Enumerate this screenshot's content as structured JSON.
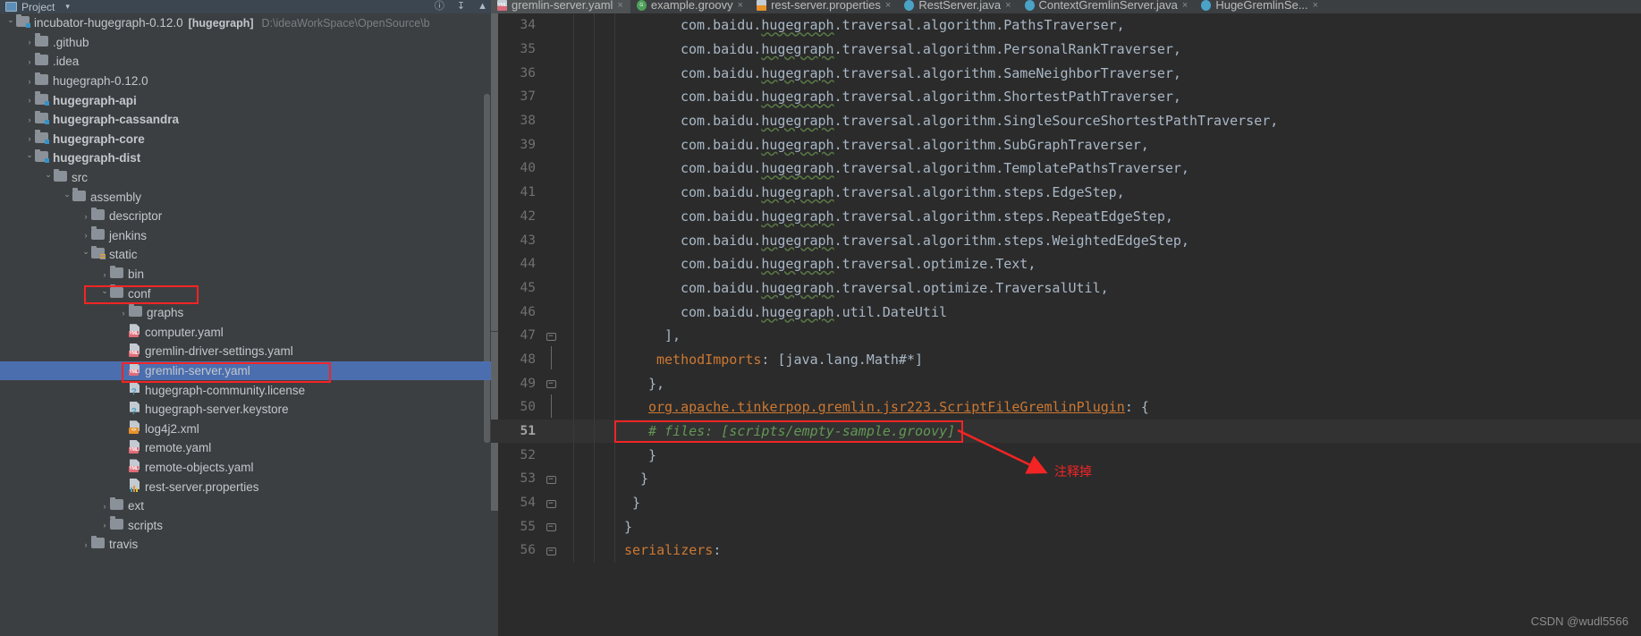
{
  "window": {
    "tool_window_title": "Project",
    "tool_window_caret": "▾",
    "toolbar_icons": [
      "locate-icon",
      "collapse-all-icon",
      "hide-icon"
    ]
  },
  "tabs": [
    {
      "label": "gremlin-server.yaml",
      "icon": "yaml-file-icon",
      "active": true,
      "close": "×"
    },
    {
      "label": "example.groovy",
      "icon": "groovy-file-icon",
      "active": false,
      "close": "×"
    },
    {
      "label": "rest-server.properties",
      "icon": "properties-file-icon",
      "active": false,
      "close": "×"
    },
    {
      "label": "RestServer.java",
      "icon": "java-file-icon",
      "active": false,
      "close": "×"
    },
    {
      "label": "ContextGremlinServer.java",
      "icon": "java-file-icon",
      "active": false,
      "close": "×"
    },
    {
      "label": "HugeGremlinSe...",
      "icon": "java-file-icon",
      "active": false,
      "close": "×"
    }
  ],
  "tree": [
    {
      "label": "incubator-hugegraph-0.12.0",
      "suffix": "[hugegraph]",
      "path": "D:\\ideaWorkSpace\\OpenSource\\b",
      "indent": 0,
      "state": "open",
      "icon": "module-folder-icon",
      "bold": false
    },
    {
      "label": ".github",
      "indent": 1,
      "state": "closed",
      "icon": "folder-icon",
      "bold": false
    },
    {
      "label": ".idea",
      "indent": 1,
      "state": "closed",
      "icon": "folder-icon",
      "bold": false
    },
    {
      "label": "hugegraph-0.12.0",
      "indent": 1,
      "state": "closed",
      "icon": "folder-icon",
      "bold": false
    },
    {
      "label": "hugegraph-api",
      "indent": 1,
      "state": "closed",
      "icon": "module-folder-icon",
      "bold": true
    },
    {
      "label": "hugegraph-cassandra",
      "indent": 1,
      "state": "closed",
      "icon": "module-folder-icon",
      "bold": true
    },
    {
      "label": "hugegraph-core",
      "indent": 1,
      "state": "closed",
      "icon": "module-folder-icon",
      "bold": true
    },
    {
      "label": "hugegraph-dist",
      "indent": 1,
      "state": "open",
      "icon": "module-folder-icon",
      "bold": true
    },
    {
      "label": "src",
      "indent": 2,
      "state": "open",
      "icon": "folder-icon",
      "bold": false
    },
    {
      "label": "assembly",
      "indent": 3,
      "state": "open",
      "icon": "folder-icon",
      "bold": false
    },
    {
      "label": "descriptor",
      "indent": 4,
      "state": "closed",
      "icon": "folder-icon",
      "bold": false
    },
    {
      "label": "jenkins",
      "indent": 4,
      "state": "closed",
      "icon": "folder-icon",
      "bold": false
    },
    {
      "label": "static",
      "indent": 4,
      "state": "open",
      "icon": "resource-folder-icon",
      "bold": false
    },
    {
      "label": "bin",
      "indent": 5,
      "state": "closed",
      "icon": "folder-icon",
      "bold": false
    },
    {
      "label": "conf",
      "indent": 5,
      "state": "open",
      "icon": "folder-icon",
      "bold": false,
      "highlight_box": true
    },
    {
      "label": "graphs",
      "indent": 6,
      "state": "closed",
      "icon": "folder-icon",
      "bold": false
    },
    {
      "label": "computer.yaml",
      "indent": 6,
      "state": "none",
      "icon": "yaml-file-icon",
      "bold": false
    },
    {
      "label": "gremlin-driver-settings.yaml",
      "indent": 6,
      "state": "none",
      "icon": "yaml-file-icon",
      "bold": false
    },
    {
      "label": "gremlin-server.yaml",
      "indent": 6,
      "state": "none",
      "icon": "yaml-file-icon",
      "bold": false,
      "selected": true,
      "highlight_box": true
    },
    {
      "label": "hugegraph-community.license",
      "indent": 6,
      "state": "none",
      "icon": "unknown-file-icon",
      "bold": false
    },
    {
      "label": "hugegraph-server.keystore",
      "indent": 6,
      "state": "none",
      "icon": "unknown-file-icon",
      "bold": false
    },
    {
      "label": "log4j2.xml",
      "indent": 6,
      "state": "none",
      "icon": "xml-file-icon",
      "bold": false
    },
    {
      "label": "remote.yaml",
      "indent": 6,
      "state": "none",
      "icon": "yaml-file-icon",
      "bold": false
    },
    {
      "label": "remote-objects.yaml",
      "indent": 6,
      "state": "none",
      "icon": "yaml-file-icon",
      "bold": false
    },
    {
      "label": "rest-server.properties",
      "indent": 6,
      "state": "none",
      "icon": "properties-file-icon",
      "bold": false
    },
    {
      "label": "ext",
      "indent": 5,
      "state": "closed",
      "icon": "folder-icon",
      "bold": false
    },
    {
      "label": "scripts",
      "indent": 5,
      "state": "closed",
      "icon": "folder-icon",
      "bold": false
    },
    {
      "label": "travis",
      "indent": 4,
      "state": "closed",
      "icon": "folder-icon",
      "bold": false
    }
  ],
  "editor": {
    "lines": [
      {
        "num": "34",
        "fold": "",
        "indent": 10,
        "text": "com.baidu.hugegraph.traversal.algorithm.PathsTraverser,",
        "style": "import"
      },
      {
        "num": "35",
        "fold": "",
        "indent": 10,
        "text": "com.baidu.hugegraph.traversal.algorithm.PersonalRankTraverser,",
        "style": "import"
      },
      {
        "num": "36",
        "fold": "",
        "indent": 10,
        "text": "com.baidu.hugegraph.traversal.algorithm.SameNeighborTraverser,",
        "style": "import"
      },
      {
        "num": "37",
        "fold": "",
        "indent": 10,
        "text": "com.baidu.hugegraph.traversal.algorithm.ShortestPathTraverser,",
        "style": "import"
      },
      {
        "num": "38",
        "fold": "",
        "indent": 10,
        "text": "com.baidu.hugegraph.traversal.algorithm.SingleSourceShortestPathTraverser,",
        "style": "import"
      },
      {
        "num": "39",
        "fold": "",
        "indent": 10,
        "text": "com.baidu.hugegraph.traversal.algorithm.SubGraphTraverser,",
        "style": "import"
      },
      {
        "num": "40",
        "fold": "",
        "indent": 10,
        "text": "com.baidu.hugegraph.traversal.algorithm.TemplatePathsTraverser,",
        "style": "import"
      },
      {
        "num": "41",
        "fold": "",
        "indent": 10,
        "text": "com.baidu.hugegraph.traversal.algorithm.steps.EdgeStep,",
        "style": "import"
      },
      {
        "num": "42",
        "fold": "",
        "indent": 10,
        "text": "com.baidu.hugegraph.traversal.algorithm.steps.RepeatEdgeStep,",
        "style": "import"
      },
      {
        "num": "43",
        "fold": "",
        "indent": 10,
        "text": "com.baidu.hugegraph.traversal.algorithm.steps.WeightedEdgeStep,",
        "style": "import"
      },
      {
        "num": "44",
        "fold": "",
        "indent": 10,
        "text": "com.baidu.hugegraph.traversal.optimize.Text,",
        "style": "import"
      },
      {
        "num": "45",
        "fold": "",
        "indent": 10,
        "text": "com.baidu.hugegraph.traversal.optimize.TraversalUtil,",
        "style": "import"
      },
      {
        "num": "46",
        "fold": "",
        "indent": 10,
        "text": "com.baidu.hugegraph.util.DateUtil",
        "style": "import"
      },
      {
        "num": "47",
        "fold": "minus",
        "indent": 8,
        "text": "],",
        "style": "plain"
      },
      {
        "num": "48",
        "fold": "bar",
        "indent": 7,
        "text": "methodImports: [java.lang.Math#*]",
        "style": "keyvalue",
        "key": "methodImports",
        "value": " [java.lang.Math#*]"
      },
      {
        "num": "49",
        "fold": "minus",
        "indent": 6,
        "text": "},",
        "style": "plain"
      },
      {
        "num": "50",
        "fold": "bar",
        "indent": 6,
        "text": "org.apache.tinkerpop.gremlin.jsr223.ScriptFileGremlinPlugin: {",
        "style": "keyvalue-underline",
        "key": "org.apache.tinkerpop.gremlin.jsr223.ScriptFileGremlinPlugin",
        "value": " {"
      },
      {
        "num": "51",
        "fold": "",
        "indent": 6,
        "text": "# files: [scripts/empty-sample.groovy]",
        "style": "comment",
        "current": true,
        "bold_num": true,
        "highlight_box": true
      },
      {
        "num": "52",
        "fold": "",
        "indent": 6,
        "text": "}",
        "style": "plain"
      },
      {
        "num": "53",
        "fold": "minus",
        "indent": 5,
        "text": "}",
        "style": "plain"
      },
      {
        "num": "54",
        "fold": "minus",
        "indent": 4,
        "text": "}",
        "style": "plain"
      },
      {
        "num": "55",
        "fold": "minus",
        "indent": 3,
        "text": "}",
        "style": "plain"
      },
      {
        "num": "56",
        "fold": "minus",
        "indent": 3,
        "text": "serializers:",
        "style": "keyvalue",
        "key": "serializers",
        "value": ""
      }
    ]
  },
  "annotation": {
    "note_text": "注释掉",
    "arrow_color": "#f42424",
    "box_color": "#f42424"
  },
  "watermark": "CSDN @wudl5566",
  "colors": {
    "panel_bg": "#3c3f41",
    "editor_bg": "#2b2b2b",
    "selection_blue": "#4b6eaf",
    "accent_orange": "#cc7832",
    "comment_green": "#629755",
    "text_gray": "#a9b7c6"
  }
}
